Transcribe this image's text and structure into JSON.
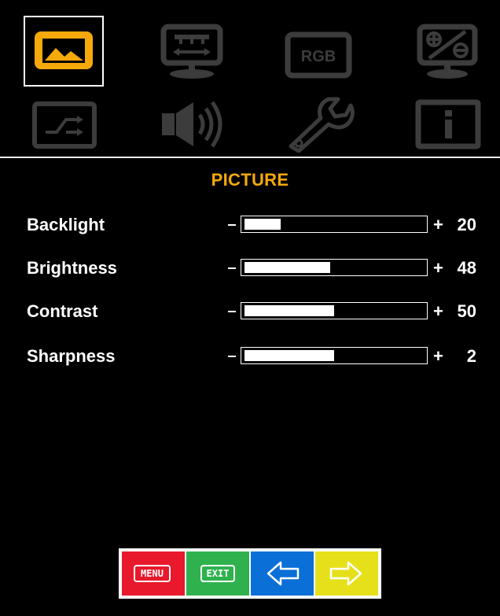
{
  "menu": {
    "title": "PICTURE",
    "tabs": [
      {
        "name": "picture",
        "icon": "picture-icon",
        "selected": true
      },
      {
        "name": "screen",
        "icon": "screen-position-icon"
      },
      {
        "name": "rgb",
        "icon": "rgb-icon",
        "label": "RGB"
      },
      {
        "name": "color-adjust",
        "icon": "color-adjust-icon"
      },
      {
        "name": "input",
        "icon": "input-source-icon"
      },
      {
        "name": "audio",
        "icon": "speaker-icon"
      },
      {
        "name": "setup",
        "icon": "wrench-icon"
      },
      {
        "name": "info",
        "icon": "info-icon"
      }
    ],
    "settings": [
      {
        "label": "Backlight",
        "value": "20",
        "level": 20
      },
      {
        "label": "Brightness",
        "value": "48",
        "level": 48
      },
      {
        "label": "Contrast",
        "value": "50",
        "level": 50
      },
      {
        "label": "Sharpness",
        "value": "2",
        "level": 50
      }
    ],
    "minus_symbol": "−",
    "plus_symbol": "+"
  },
  "buttons": {
    "menu_label": "MENU",
    "exit_label": "EXIT",
    "left_icon": "left-arrow-icon",
    "right_icon": "right-arrow-icon"
  },
  "colors": {
    "accent": "#f5a90a",
    "inactive_icon": "#3c3c3c",
    "menu_btn": "#e8192c",
    "exit_btn": "#2fb24e",
    "left_btn": "#0a6fd6",
    "right_btn": "#e6e01a"
  }
}
